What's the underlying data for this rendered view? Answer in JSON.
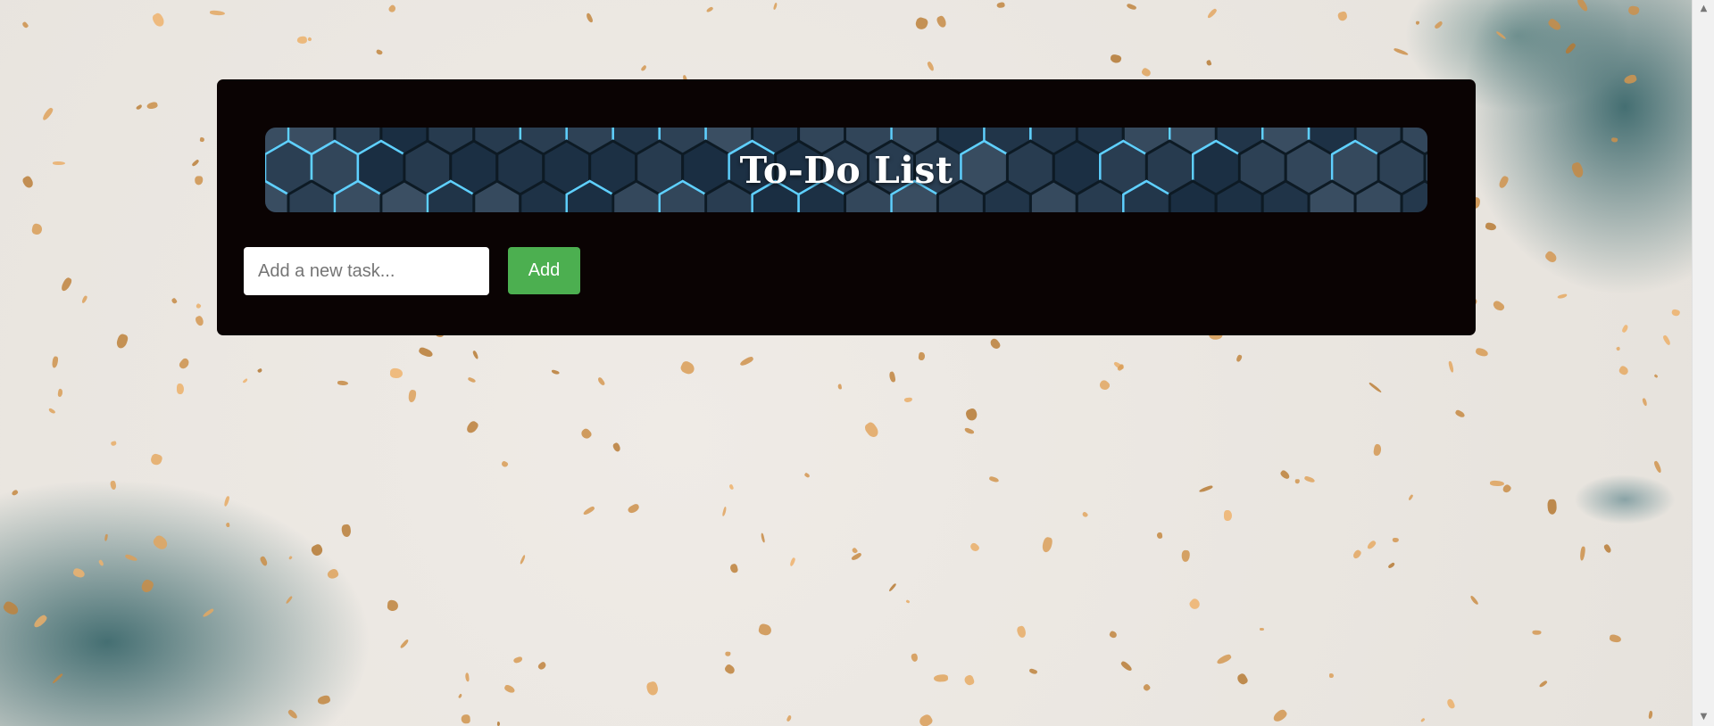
{
  "app": {
    "title": "To-Do List"
  },
  "form": {
    "input_placeholder": "Add a new task...",
    "input_value": "",
    "add_label": "Add"
  },
  "colors": {
    "card_background": "#0a0303",
    "add_button": "#4caf50",
    "page_background": "#e8e4de"
  },
  "icons": {
    "scroll_up": "scroll-up-arrow-icon",
    "scroll_down": "scroll-down-arrow-icon"
  }
}
